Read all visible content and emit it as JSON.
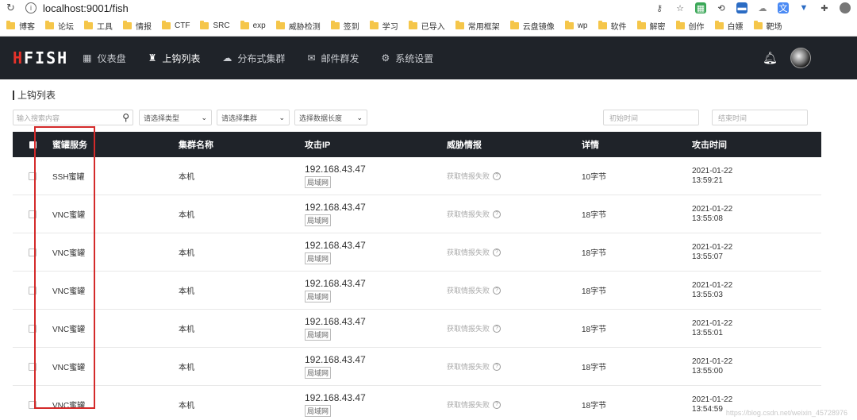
{
  "browser": {
    "url": "localhost:9001/fish",
    "bookmarks": [
      "博客",
      "论坛",
      "工具",
      "情报",
      "CTF",
      "SRC",
      "exp",
      "威胁检测",
      "签到",
      "学习",
      "已导入",
      "常用框架",
      "云盘镜像",
      "wp",
      "软件",
      "解密",
      "创作",
      "白嫖",
      "靶场"
    ]
  },
  "app": {
    "logo": "FISH",
    "logo_prefix": "H",
    "nav": [
      "仪表盘",
      "上钩列表",
      "分布式集群",
      "邮件群发",
      "系统设置"
    ]
  },
  "page": {
    "title": "上钩列表",
    "filters": {
      "search_placeholder": "输入搜索内容",
      "type_select": "请选择类型",
      "cluster_select": "请选择集群",
      "length_select": "选择数据长度",
      "start_time": "初始时间",
      "end_time": "结束时间"
    },
    "table": {
      "headers": [
        "蜜罐服务",
        "集群名称",
        "攻击IP",
        "威胁情报",
        "详情",
        "攻击时间"
      ],
      "rows": [
        {
          "service": "SSH蜜罐",
          "cluster": "本机",
          "ip": "192.168.43.47",
          "ip_tag": "局域网",
          "intel": "获取情报失败",
          "detail": "10字节",
          "date": "2021-01-22",
          "time": "13:59:21"
        },
        {
          "service": "VNC蜜罐",
          "cluster": "本机",
          "ip": "192.168.43.47",
          "ip_tag": "局域网",
          "intel": "获取情报失败",
          "detail": "18字节",
          "date": "2021-01-22",
          "time": "13:55:08"
        },
        {
          "service": "VNC蜜罐",
          "cluster": "本机",
          "ip": "192.168.43.47",
          "ip_tag": "局域网",
          "intel": "获取情报失败",
          "detail": "18字节",
          "date": "2021-01-22",
          "time": "13:55:07"
        },
        {
          "service": "VNC蜜罐",
          "cluster": "本机",
          "ip": "192.168.43.47",
          "ip_tag": "局域网",
          "intel": "获取情报失败",
          "detail": "18字节",
          "date": "2021-01-22",
          "time": "13:55:03"
        },
        {
          "service": "VNC蜜罐",
          "cluster": "本机",
          "ip": "192.168.43.47",
          "ip_tag": "局域网",
          "intel": "获取情报失败",
          "detail": "18字节",
          "date": "2021-01-22",
          "time": "13:55:01"
        },
        {
          "service": "VNC蜜罐",
          "cluster": "本机",
          "ip": "192.168.43.47",
          "ip_tag": "局域网",
          "intel": "获取情报失败",
          "detail": "18字节",
          "date": "2021-01-22",
          "time": "13:55:00"
        },
        {
          "service": "VNC蜜罐",
          "cluster": "本机",
          "ip": "192.168.43.47",
          "ip_tag": "局域网",
          "intel": "获取情报失败",
          "detail": "18字节",
          "date": "2021-01-22",
          "time": "13:54:59"
        }
      ]
    }
  },
  "watermark": "https://blog.csdn.net/weixin_45728976"
}
